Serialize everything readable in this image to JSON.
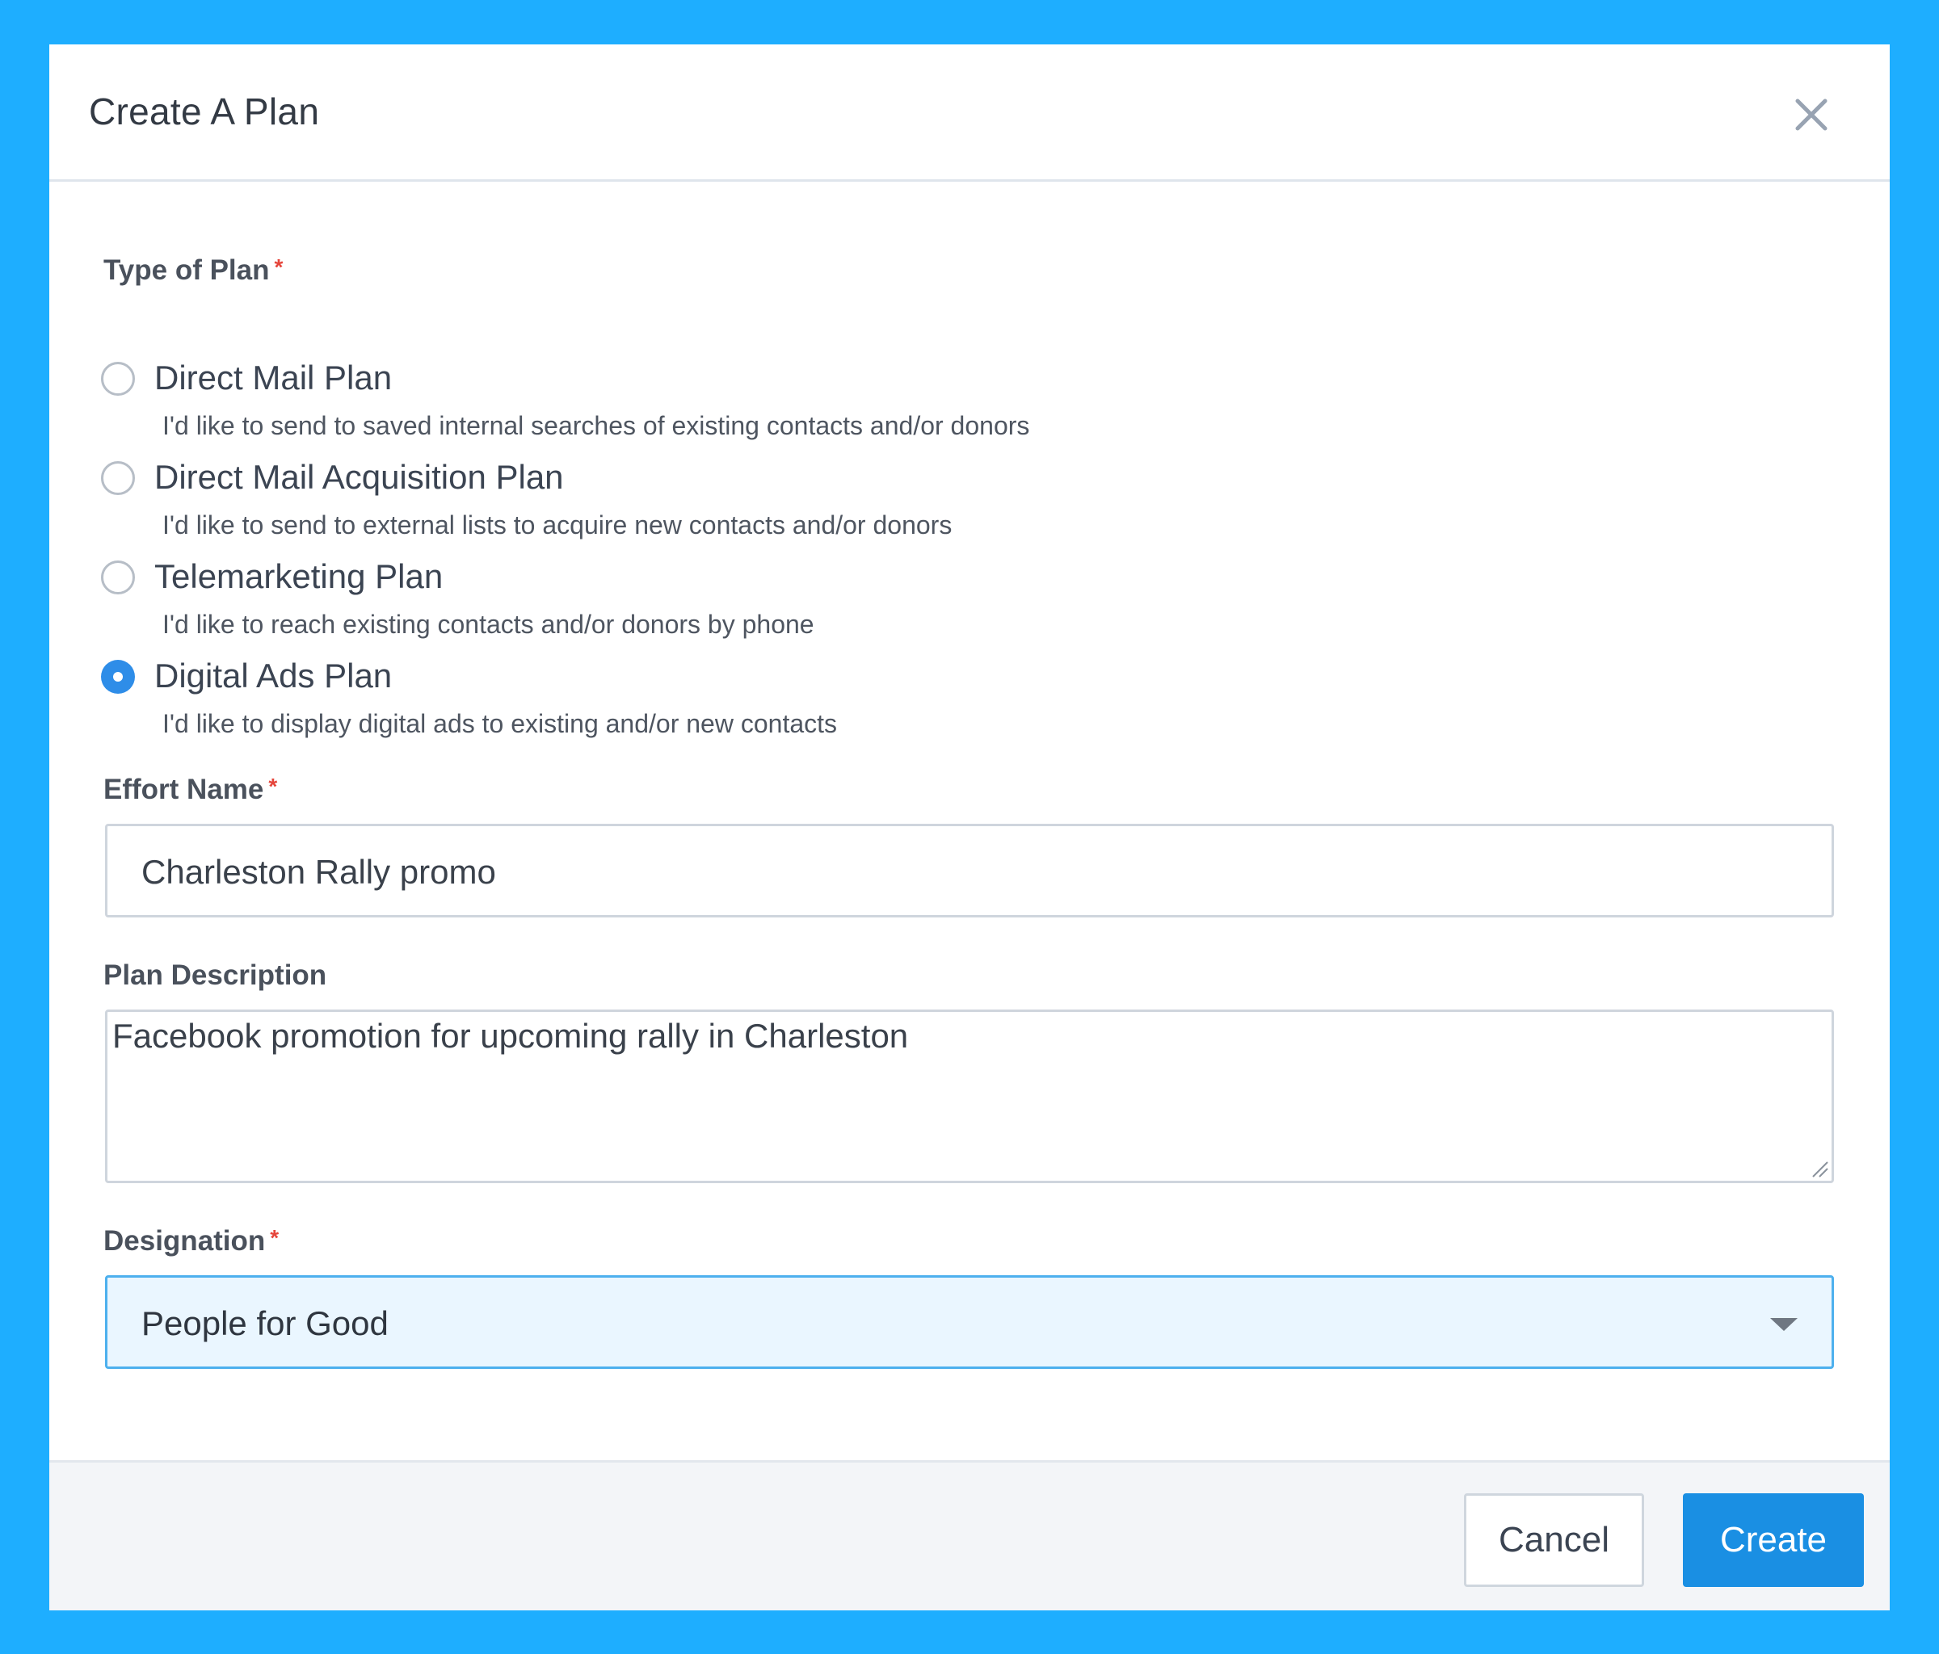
{
  "modal": {
    "title": "Create A Plan"
  },
  "plan_type": {
    "label": "Type of Plan",
    "required_mark": "*",
    "options": [
      {
        "label": "Direct Mail Plan",
        "description": "I'd like to send to saved internal searches of existing contacts and/or donors",
        "checked": false
      },
      {
        "label": "Direct Mail Acquisition Plan",
        "description": "I'd like to send to external lists to acquire new contacts and/or donors",
        "checked": false
      },
      {
        "label": "Telemarketing Plan",
        "description": "I'd like to reach existing contacts and/or donors by phone",
        "checked": false
      },
      {
        "label": "Digital Ads Plan",
        "description": "I'd like to display digital ads to existing and/or new contacts",
        "checked": true
      }
    ]
  },
  "effort_name": {
    "label": "Effort Name",
    "required_mark": "*",
    "value": "Charleston Rally promo"
  },
  "plan_description": {
    "label": "Plan Description",
    "value": "Facebook promotion for upcoming rally in Charleston"
  },
  "designation": {
    "label": "Designation",
    "required_mark": "*",
    "selected": "People for Good"
  },
  "footer": {
    "cancel_label": "Cancel",
    "create_label": "Create"
  },
  "colors": {
    "background": "#1eaeff",
    "accent": "#1a8fe3",
    "required": "#e5453b"
  },
  "icons": {
    "close": "close-icon",
    "select_caret": "chevron-down-icon",
    "resize": "resize-handle-icon"
  }
}
